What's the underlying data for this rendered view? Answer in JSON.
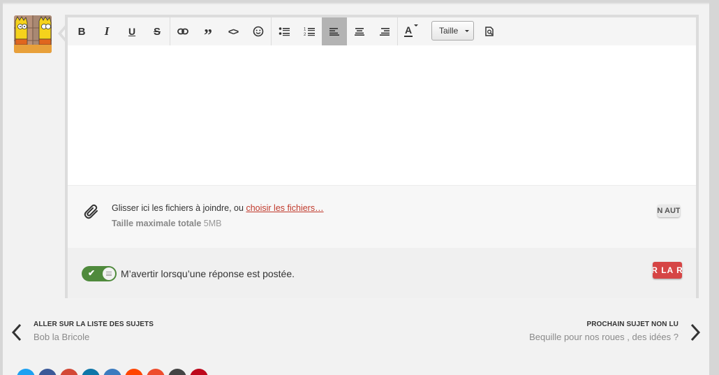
{
  "editor": {
    "toolbar": {
      "bold_label": "B",
      "italic_label": "I",
      "underline_label": "U",
      "strike_label": "S",
      "quote_label": "”",
      "code_label": "<>",
      "text_color_label": "A",
      "size_select_label": "Taille"
    },
    "attachments": {
      "drop_text": "Glisser ici les fichiers à joindre, ou",
      "choose_link": "choisir les fichiers…",
      "max_label": "Taille maximale totale",
      "max_value": "5MB",
      "other_button_label": "N AUT"
    },
    "notify_label": "M’avertir lorsqu’une réponse est postée.",
    "notify_enabled": true,
    "submit_label": "R LA R"
  },
  "navigation": {
    "prev_title": "ALLER SUR LA LISTE DES SUJETS",
    "prev_subtitle": "Bob la Bricole",
    "next_title": "PROCHAIN SUJET NON LU",
    "next_subtitle": "Bequille pour nos roues , des idées ?"
  },
  "share": {
    "colors": [
      "#1da1f2",
      "#3b5998",
      "#d34836",
      "#0e76a8",
      "#3b7bbf",
      "#ff4500",
      "#ee4d2d",
      "#444444",
      "#bd081c"
    ]
  },
  "colors": {
    "accent_red": "#d64545",
    "link_red": "#c0392b",
    "toggle_green": "#4f8a3c",
    "active_tool": "#b3b3b3"
  }
}
